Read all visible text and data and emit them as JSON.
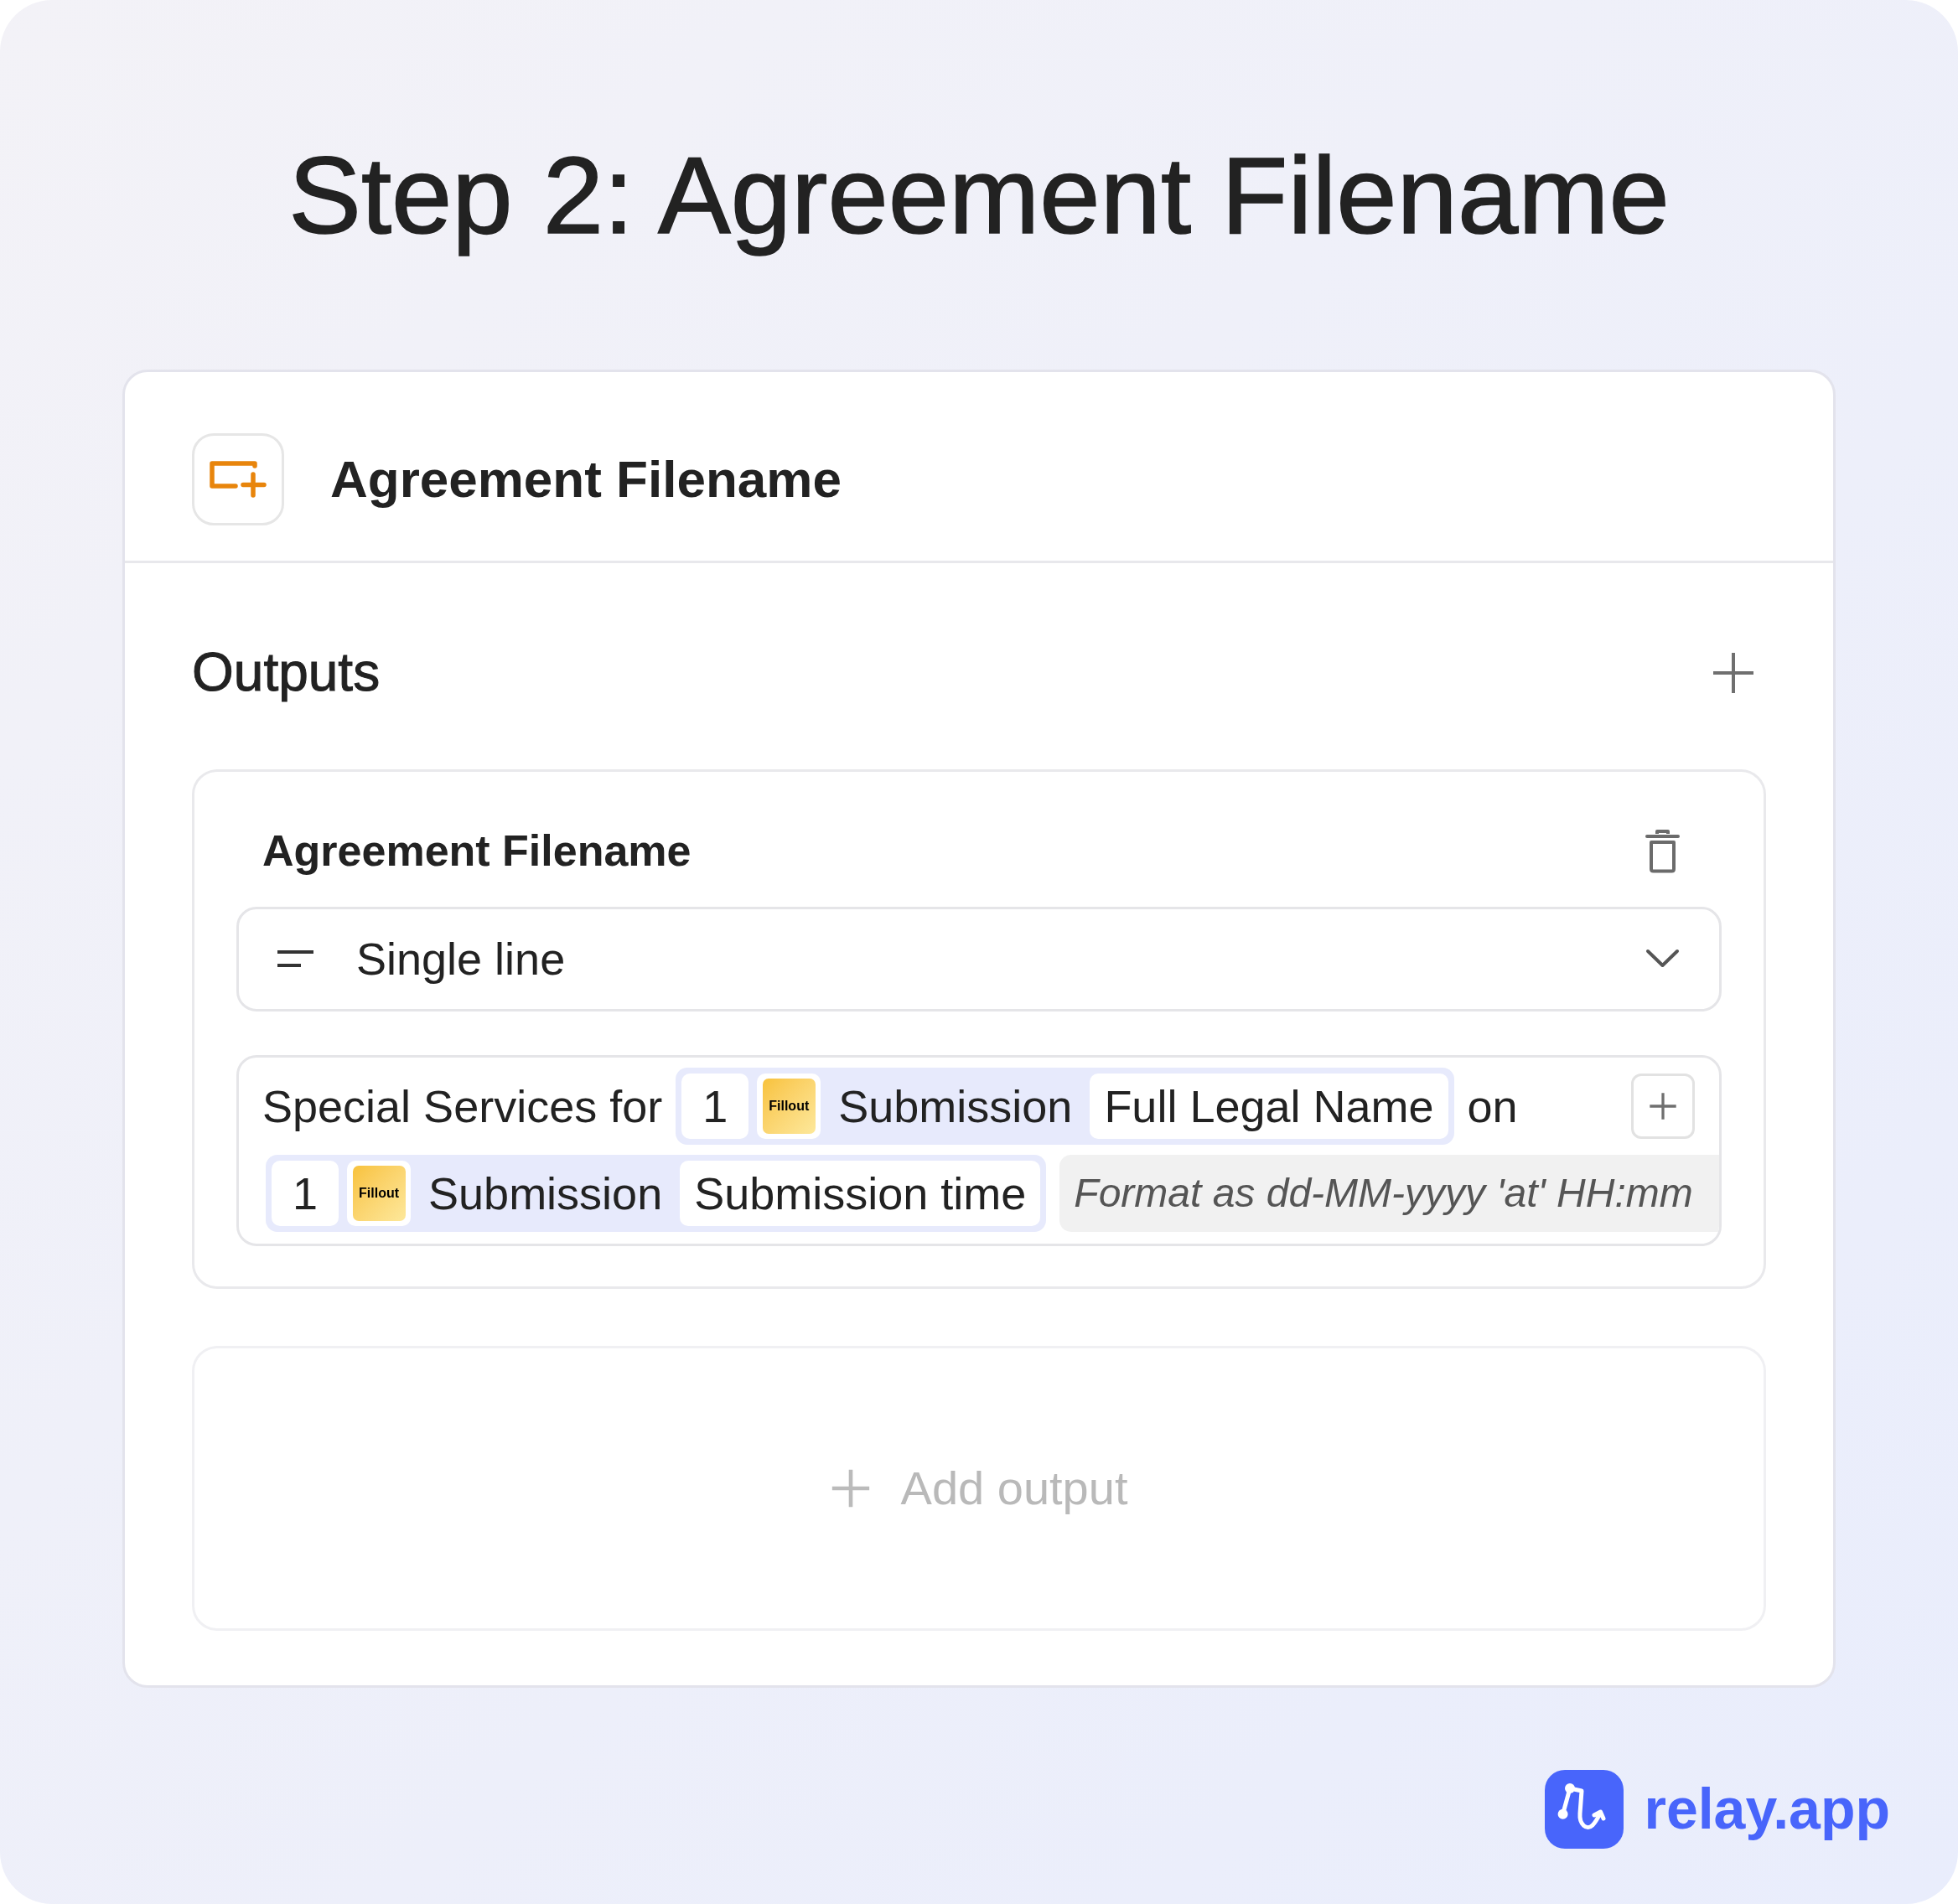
{
  "title": "Step 2: Agreement Filename",
  "step": {
    "name": "Agreement Filename"
  },
  "outputs": {
    "heading": "Outputs",
    "items": [
      {
        "name": "Agreement Filename",
        "type": "Single line",
        "value": {
          "lines": [
            [
              {
                "kind": "text",
                "text": "Special Services for"
              },
              {
                "kind": "reference",
                "step": "1",
                "app": "Fillout",
                "source": "Submission",
                "field": "Full Legal Name"
              },
              {
                "kind": "text",
                "text": "on"
              }
            ],
            [
              {
                "kind": "reference",
                "step": "1",
                "app": "Fillout",
                "source": "Submission",
                "field": "Submission time"
              },
              {
                "kind": "format",
                "text": "Format as dd-MM-yyyy 'at' HH:mm"
              }
            ]
          ]
        }
      }
    ],
    "add_button": "Add output"
  },
  "brand": "relay.app"
}
